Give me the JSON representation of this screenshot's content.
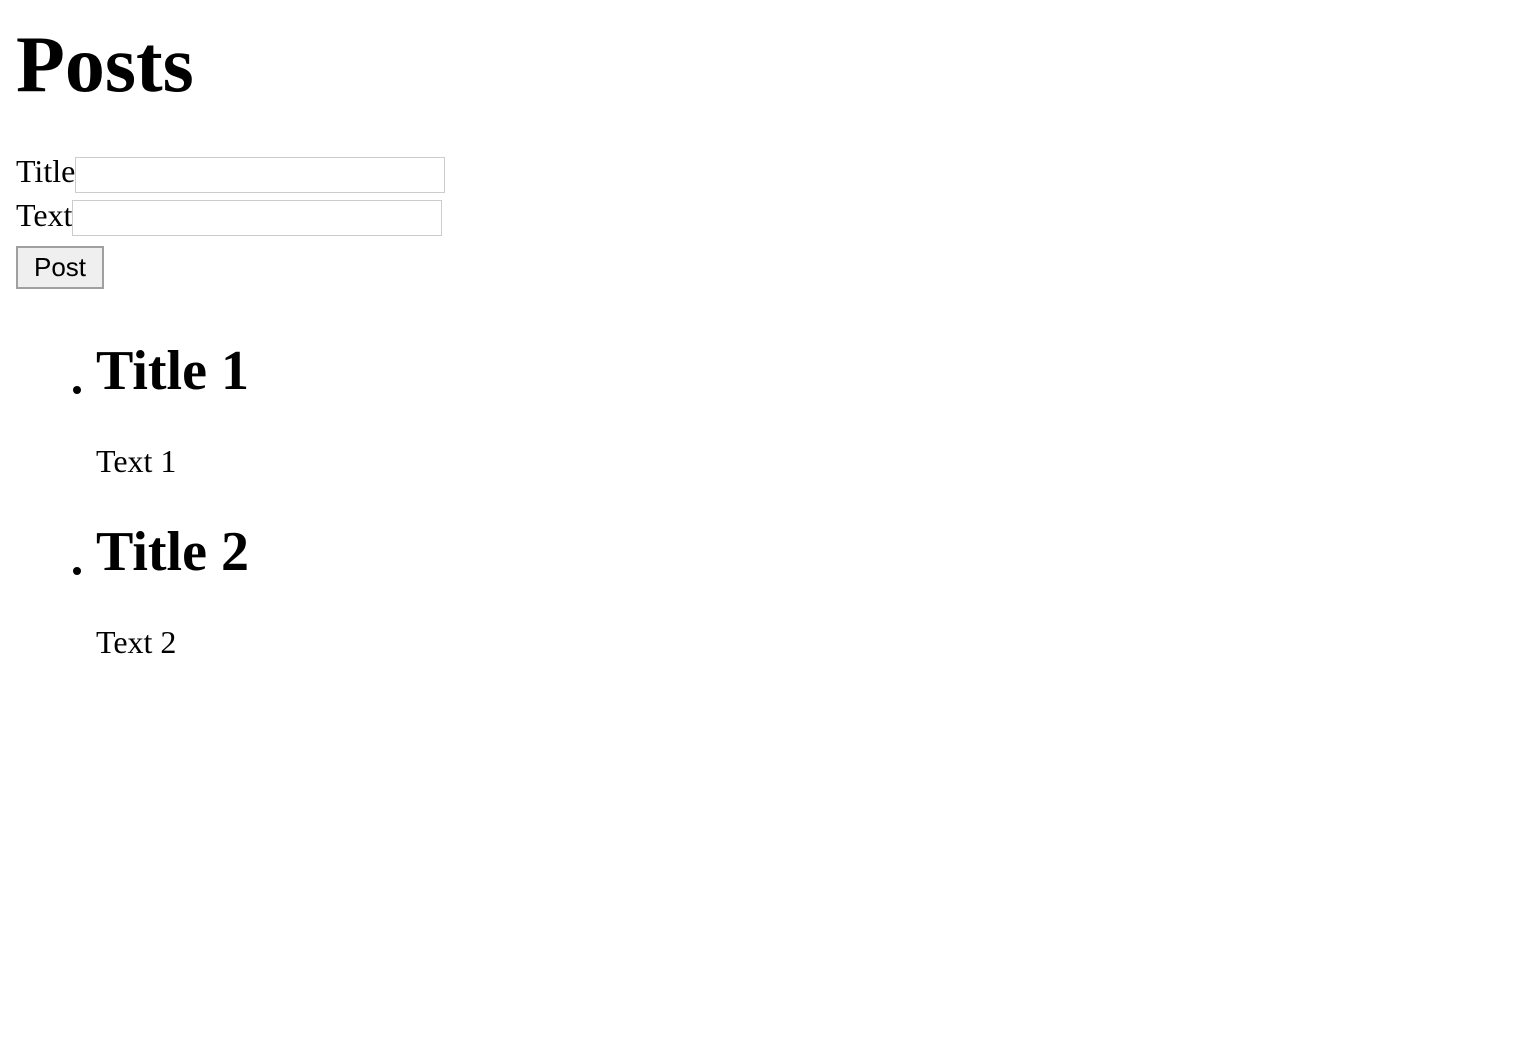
{
  "page": {
    "title": "Posts"
  },
  "form": {
    "title_label": "Title",
    "title_value": "",
    "text_label": "Text",
    "text_value": "",
    "submit_label": "Post"
  },
  "posts": [
    {
      "title": "Title 1",
      "text": "Text 1"
    },
    {
      "title": "Title 2",
      "text": "Text 2"
    }
  ]
}
